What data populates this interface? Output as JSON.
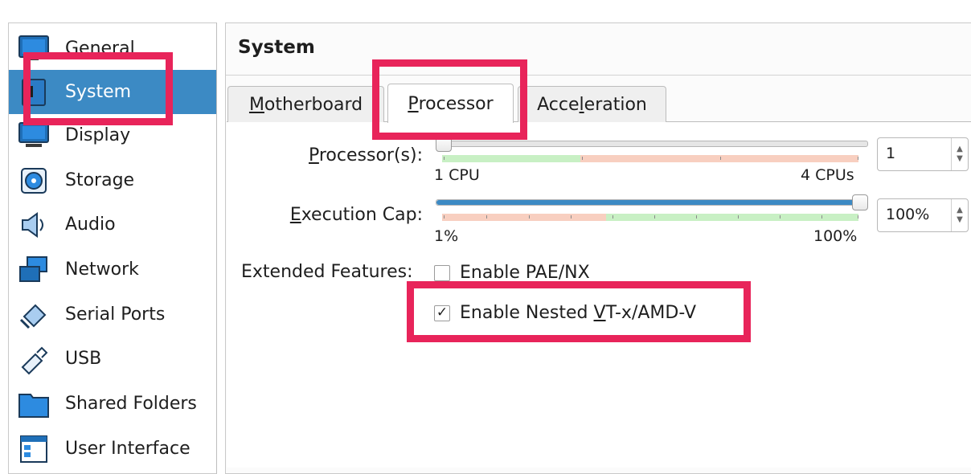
{
  "sidebar": {
    "items": [
      {
        "label": "General",
        "icon": "monitor-icon",
        "selected": false
      },
      {
        "label": "System",
        "icon": "chip-icon",
        "selected": true
      },
      {
        "label": "Display",
        "icon": "display-icon",
        "selected": false
      },
      {
        "label": "Storage",
        "icon": "storage-icon",
        "selected": false
      },
      {
        "label": "Audio",
        "icon": "speaker-icon",
        "selected": false
      },
      {
        "label": "Network",
        "icon": "network-icon",
        "selected": false
      },
      {
        "label": "Serial Ports",
        "icon": "serial-port-icon",
        "selected": false
      },
      {
        "label": "USB",
        "icon": "usb-icon",
        "selected": false
      },
      {
        "label": "Shared Folders",
        "icon": "folder-icon",
        "selected": false
      },
      {
        "label": "User Interface",
        "icon": "user-interface-icon",
        "selected": false
      }
    ]
  },
  "page": {
    "title": "System"
  },
  "tabs": [
    {
      "label": "Motherboard",
      "mnemonic": "M",
      "rest": "otherboard",
      "active": false
    },
    {
      "label": "Processor",
      "mnemonic": "P",
      "rest": "rocessor",
      "active": true
    },
    {
      "label": "Acceleration",
      "pre": "Acce",
      "mnemonic": "l",
      "rest": "eration",
      "active": false
    }
  ],
  "processor": {
    "label_mnemonic": "P",
    "label_rest": "rocessor(s):",
    "min_label": "1 CPU",
    "max_label": "4 CPUs",
    "value": "1",
    "min": 1,
    "max": 4,
    "current": 1
  },
  "execution_cap": {
    "label_mnemonic": "E",
    "label_rest": "xecution Cap:",
    "min_label": "1%",
    "max_label": "100%",
    "value": "100%",
    "min": 1,
    "max": 100,
    "current": 100
  },
  "extended_features": {
    "label": "Extended Features:",
    "pae": {
      "label": "Enable PAE/NX",
      "checked": false
    },
    "nested": {
      "pre": "Enable Nested ",
      "mnemonic": "V",
      "rest": "T-x/AMD-V",
      "checked": true
    }
  },
  "colors": {
    "accent": "#3c8ac4",
    "highlight": "#e8245a",
    "range_good": "#c8f0c4",
    "range_warn": "#f8cfc0"
  }
}
